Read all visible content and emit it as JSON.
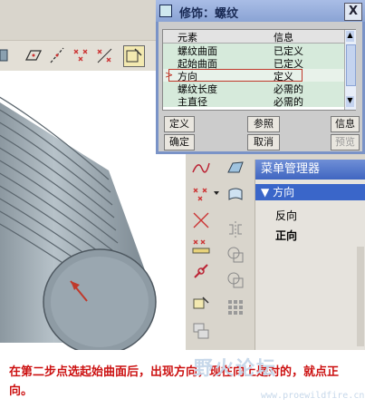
{
  "dialog": {
    "title": "修饰：螺纹",
    "close": "X",
    "columns": [
      "元素",
      "信息"
    ],
    "rows": [
      {
        "element": "螺纹曲面",
        "info": "已定义"
      },
      {
        "element": "起始曲面",
        "info": "已定义"
      },
      {
        "element": "方向",
        "info": "定义"
      },
      {
        "element": "螺纹长度",
        "info": "必需的"
      },
      {
        "element": "主直径",
        "info": "必需的"
      }
    ],
    "selected_marker": ">",
    "buttons": {
      "define": "定义",
      "reference": "参照",
      "info": "信息",
      "ok": "确定",
      "cancel": "取消",
      "preview": "预览"
    }
  },
  "menu_manager": {
    "title": "菜单管理器",
    "submenu": "方向",
    "items": [
      "反向",
      "正向"
    ]
  },
  "caption": "在第二步点选起始曲面后，出现方向，现在向上是对的，就点正向。",
  "watermark": {
    "text": "野火论坛",
    "url": "www.proewildfire.cn"
  },
  "colors": {
    "dialog_title": "#8aa3d4",
    "menu_title": "#4066c1",
    "caption_text": "#cc1111",
    "arrow": "#c0392b"
  }
}
